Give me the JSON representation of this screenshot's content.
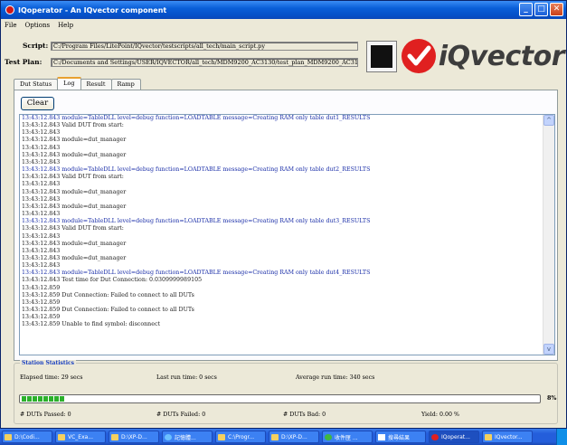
{
  "window": {
    "title": "IQoperator - An IQvector component",
    "buttons": {
      "minimize": "_",
      "maximize": "□",
      "close": "✕"
    }
  },
  "menu": [
    "File",
    "Options",
    "Help"
  ],
  "script": {
    "label": "Script:",
    "value": "C:/Program Files/LitePoint/IQvector/testscripts/all_tech/main_script.py"
  },
  "test_plan": {
    "label": "Test Plan:",
    "value": "C:/Documents and Settings/USER/IQVECTOR/all_tech/MDM9200_AC3130/test_plan_MDM9200_AC3130.ini"
  },
  "logo": {
    "text": "iQvector",
    "brand_color": "#e02020"
  },
  "tabs": [
    {
      "label": "Dut Status",
      "active": false
    },
    {
      "label": "Log",
      "active": true
    },
    {
      "label": "Result",
      "active": false
    },
    {
      "label": "Ramp",
      "active": false
    }
  ],
  "clear_label": "Clear",
  "log": [
    {
      "text": "13:43:12.843 module=TableDLL level=debug function=LOADTABLE message=Creating RAM only table dut1_RESULTS",
      "blue": true
    },
    {
      "text": "13:43:12.843 Valid DUT from start:",
      "blue": false
    },
    {
      "text": "13:43:12.843",
      "blue": false
    },
    {
      "text": "13:43:12.843 module=dut_manager",
      "blue": false
    },
    {
      "text": "13:43:12.843",
      "blue": false
    },
    {
      "text": "13:43:12.843 module=dut_manager",
      "blue": false
    },
    {
      "text": "13:43:12.843",
      "blue": false
    },
    {
      "text": "13:43:12.843 module=TableDLL level=debug function=LOADTABLE message=Creating RAM only table dut2_RESULTS",
      "blue": true
    },
    {
      "text": "13:43:12.843 Valid DUT from start:",
      "blue": false
    },
    {
      "text": "13:43:12.843",
      "blue": false
    },
    {
      "text": "13:43:12.843 module=dut_manager",
      "blue": false
    },
    {
      "text": "13:43:12.843",
      "blue": false
    },
    {
      "text": "13:43:12.843 module=dut_manager",
      "blue": false
    },
    {
      "text": "13:43:12.843",
      "blue": false
    },
    {
      "text": "13:43:12.843 module=TableDLL level=debug function=LOADTABLE message=Creating RAM only table dut3_RESULTS",
      "blue": true
    },
    {
      "text": "13:43:12.843 Valid DUT from start:",
      "blue": false
    },
    {
      "text": "13:43:12.843",
      "blue": false
    },
    {
      "text": "13:43:12.843 module=dut_manager",
      "blue": false
    },
    {
      "text": "13:43:12.843",
      "blue": false
    },
    {
      "text": "13:43:12.843 module=dut_manager",
      "blue": false
    },
    {
      "text": "13:43:12.843",
      "blue": false
    },
    {
      "text": "13:43:12.843 module=TableDLL level=debug function=LOADTABLE message=Creating RAM only table dut4_RESULTS",
      "blue": true
    },
    {
      "text": "13:43:12.843 Test time for Dut Connection: 0.0309999989105",
      "blue": false
    },
    {
      "text": "13:43:12.859",
      "blue": false
    },
    {
      "text": "13:43:12.859 Dut Connection: Failed to connect to all DUTs",
      "blue": false
    },
    {
      "text": "13:43:12.859",
      "blue": false
    },
    {
      "text": "13:43:12.859 Dut Connection: Failed to connect to all DUTs",
      "blue": false
    },
    {
      "text": "13:43:12.859",
      "blue": false
    },
    {
      "text": "13:43:12.859 Unable to find symbol: disconnect",
      "blue": false
    }
  ],
  "stats": {
    "title": "Station Statistics",
    "elapsed": "Elapsed time:  29  secs",
    "last_run": "Last run time:  0  secs",
    "average": "Average run time:  340  secs",
    "progress_percent": 8,
    "progress_label": "8%",
    "passed": "# DUTs Passed:  0",
    "failed": "# DUTs Failed:  0",
    "bad": "# DUTs Bad:  0",
    "yield": "Yield:  0.00  %"
  },
  "taskbar": [
    {
      "label": "D:\\Codi...",
      "icon": "folder"
    },
    {
      "label": "VC_Exa...",
      "icon": "folder"
    },
    {
      "label": "D:\\XP-D...",
      "icon": "folder"
    },
    {
      "label": "記憶體...",
      "icon": "glob"
    },
    {
      "label": "C:\\Progr...",
      "icon": "folder"
    },
    {
      "label": "D:\\XP-D...",
      "icon": "folder"
    },
    {
      "label": "收件匣 ...",
      "icon": "msn"
    },
    {
      "label": "搜尋結果",
      "icon": "doc"
    },
    {
      "label": "IQoperat...",
      "icon": "red"
    },
    {
      "label": "IQvector...",
      "icon": "folder"
    }
  ]
}
